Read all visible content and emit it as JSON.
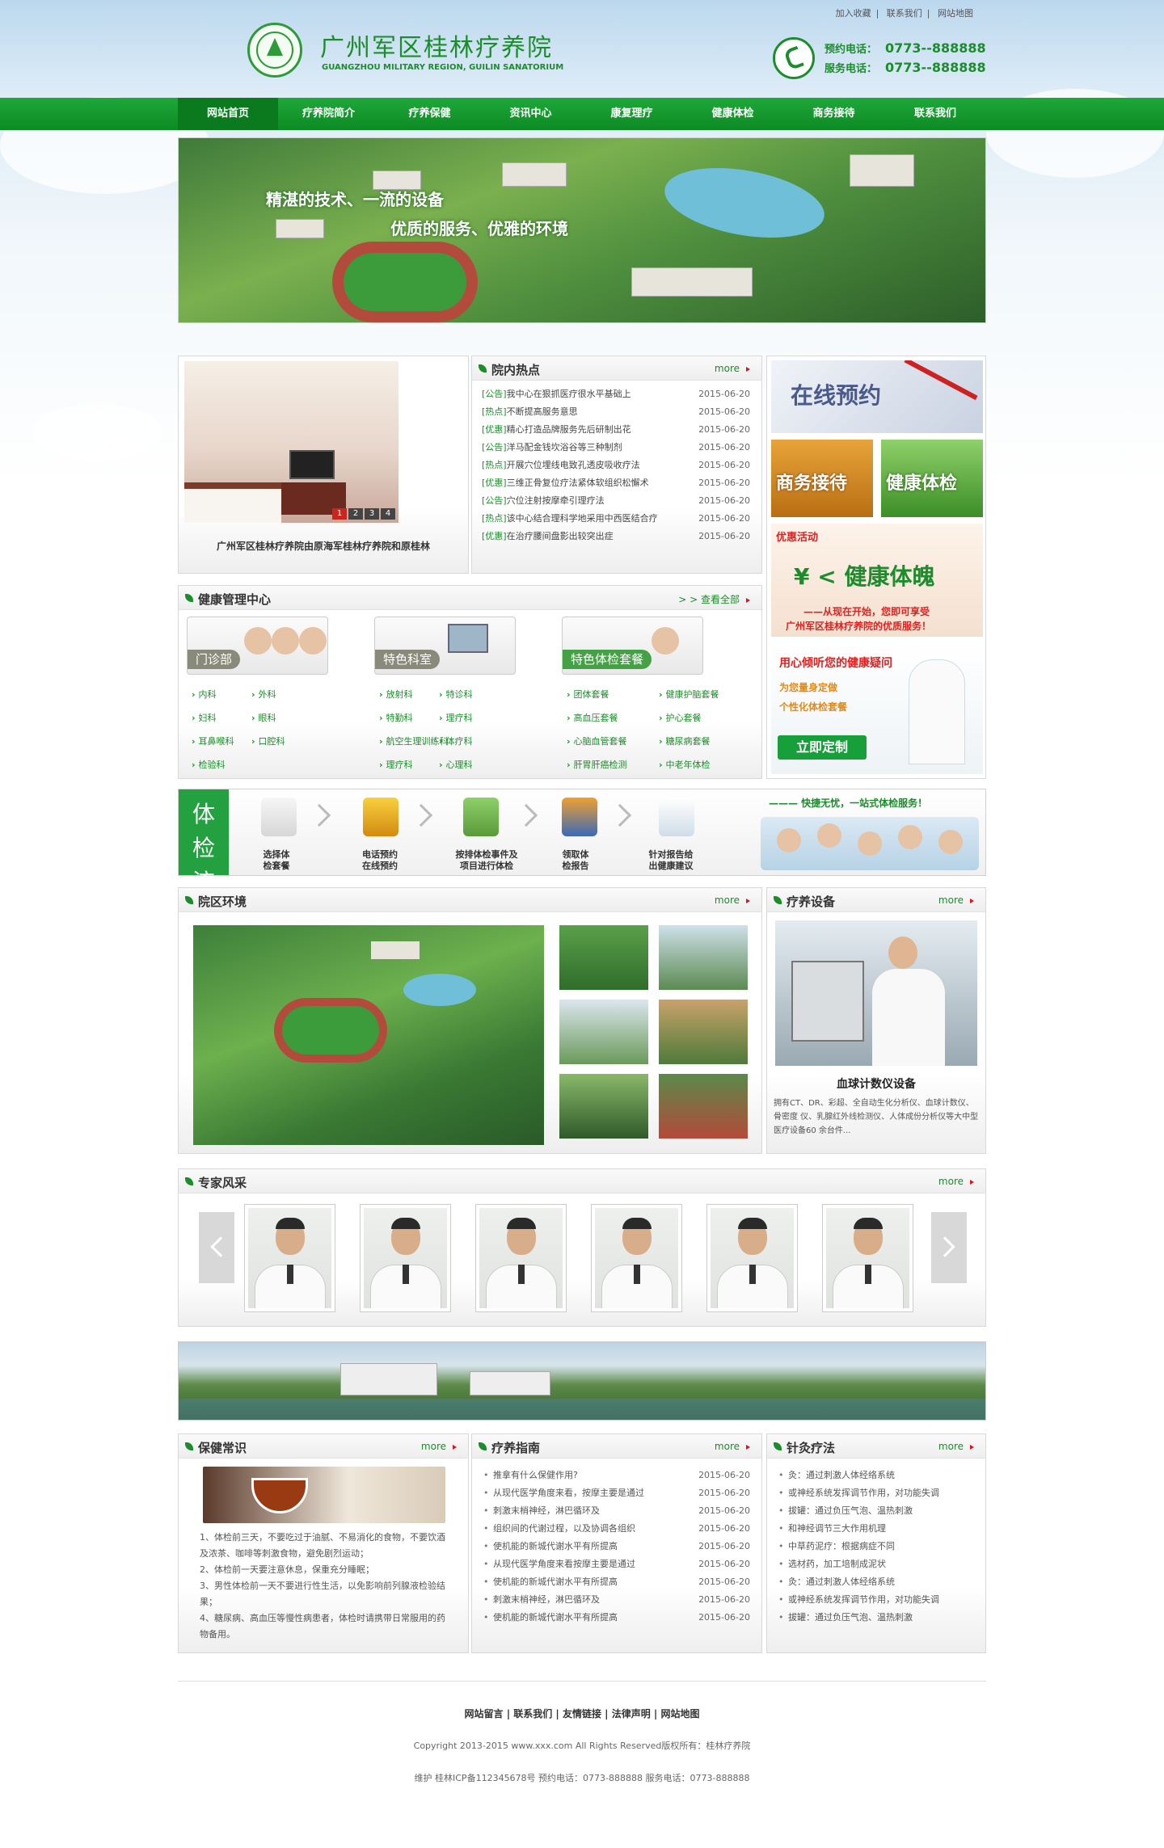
{
  "header": {
    "logo_cn": "广州军区桂林疗养院",
    "logo_en": "GUANGZHOU MILITARY REGION, GUILIN SANATORIUM",
    "top_links": [
      "加入收藏",
      "联系我们",
      "网站地图"
    ],
    "booking_label": "预约电话：",
    "booking_number": "0773--888888",
    "service_label": "服务电话：",
    "service_number": "0773--888888"
  },
  "nav": [
    "网站首页",
    "疗养院简介",
    "疗养保健",
    "资讯中心",
    "康复理疗",
    "健康体检",
    "商务接待",
    "联系我们"
  ],
  "banner": {
    "slogan1": "精湛的技术、一流的设备",
    "slogan2": "优质的服务、优雅的环境"
  },
  "slider": {
    "caption": "广州军区桂林疗养院由原海军桂林疗养院和原桂林",
    "pages": [
      "1",
      "2",
      "3",
      "4"
    ]
  },
  "hot": {
    "title": "院内热点",
    "more": "more",
    "items": [
      {
        "tag": "[公告]",
        "text": "我中心在狠抓医疗很水平基础上",
        "date": "2015-06-20"
      },
      {
        "tag": "[热点]",
        "text": "不断提高服务意思",
        "date": "2015-06-20"
      },
      {
        "tag": "[优惠]",
        "text": "精心打造品牌服务先后研制出花",
        "date": "2015-06-20"
      },
      {
        "tag": "[公告]",
        "text": "洋马配金钱坎浴谷等三种制剂",
        "date": "2015-06-20"
      },
      {
        "tag": "[热点]",
        "text": "开展穴位埋线电致孔透皮吸收疗法",
        "date": "2015-06-20"
      },
      {
        "tag": "[优惠]",
        "text": "三维正骨复位疗法紧体软组织松懈术",
        "date": "2015-06-20"
      },
      {
        "tag": "[公告]",
        "text": "穴位注射按摩牵引理疗法",
        "date": "2015-06-20"
      },
      {
        "tag": "[热点]",
        "text": "该中心结合理科学地采用中西医结合疗",
        "date": "2015-06-20"
      },
      {
        "tag": "[优惠]",
        "text": "在治疗腰间盘影出较突出症",
        "date": "2015-06-20"
      }
    ]
  },
  "ads": {
    "online": "在线预约",
    "business": "商务接待",
    "checkup": "健康体检",
    "promo_tag": "优惠活动",
    "promo_big": "¥ < 健康体魄",
    "promo_line1": "——从现在开始，您即可享受",
    "promo_line2": "广州军区桂林疗养院的优质服务！",
    "custom_title": "用心倾听您的健康疑问",
    "custom_line1": "为您量身定做",
    "custom_line2": "个性化体检套餐",
    "custom_button": "立即定制"
  },
  "health": {
    "title": "健康管理中心",
    "more": "> > 查看全部",
    "cards": [
      "门诊部",
      "特色科室",
      "特色体检套餐"
    ],
    "col1": [
      "内科",
      "外科",
      "妇科",
      "眼科",
      "耳鼻喉科",
      "口腔科",
      "检验科"
    ],
    "col2": [
      "放射科",
      "特诊科",
      "特勤科",
      "理疗科",
      "航空生理训练科",
      "体疗科",
      "理疗科",
      "心理科"
    ],
    "col3": [
      "团体套餐",
      "健康护脑套餐",
      "高血压套餐",
      "护心套餐",
      "心脑血管套餐",
      "糖尿病套餐",
      "肝胃肝癌检测",
      "中老年体检"
    ]
  },
  "flow": {
    "title1": "体 检",
    "title2": "流 程",
    "steps": [
      [
        "选择体",
        "检套餐"
      ],
      [
        "电话预约",
        "在线预约"
      ],
      [
        "按排体检事件及",
        "项目进行体检"
      ],
      [
        "领取体",
        "检报告"
      ],
      [
        "针对报告给",
        "出健康建议"
      ]
    ],
    "slogan": "——— 快捷无忧，一站式体检服务！"
  },
  "env": {
    "title": "院区环境",
    "more": "more"
  },
  "equip": {
    "title": "疗养设备",
    "more": "more",
    "name": "血球计数仪设备",
    "desc": "拥有CT、DR、彩超、全自动生化分析仪、血球计数仪、骨密度 仪、乳腺红外线检测仪、人体成份分析仪等大中型医疗设备60 余台件..."
  },
  "experts": {
    "title": "专家风采",
    "more": "more"
  },
  "care": {
    "title": "保健常识",
    "more": "more",
    "text": [
      "1、体检前三天，不要吃过于油腻、不易消化的食物，不要饮酒及浓茶、咖啡等刺激食物，避免剧烈运动；",
      "2、体检前一天要注意休息，保重充分睡眠；",
      "3、男性体检前一天不要进行性生活，以免影响前列腺液检验结果；",
      "4、糖尿病、高血压等慢性病患者，体检时请携带日常服用的药物备用。"
    ]
  },
  "guide": {
    "title": "疗养指南",
    "more": "more",
    "items": [
      {
        "text": "推拿有什么保健作用?",
        "date": "2015-06-20"
      },
      {
        "text": "从现代医学角度来看，按摩主要是通过",
        "date": "2015-06-20"
      },
      {
        "text": "刺激末梢神经，淋巴循环及",
        "date": "2015-06-20"
      },
      {
        "text": "组织间的代谢过程，以及协调各组织",
        "date": "2015-06-20"
      },
      {
        "text": "使机能的新城代谢水平有所提高",
        "date": "2015-06-20"
      },
      {
        "text": "从现代医学角度来看按摩主要是通过",
        "date": "2015-06-20"
      },
      {
        "text": "使机能的新城代谢水平有所提高",
        "date": "2015-06-20"
      },
      {
        "text": "刺激末梢神经，淋巴循环及",
        "date": "2015-06-20"
      },
      {
        "text": "使机能的新城代谢水平有所提高",
        "date": "2015-06-20"
      }
    ]
  },
  "acu": {
    "title": "针灸疗法",
    "more": "more",
    "items": [
      "灸：通过刺激人体经络系统",
      "或神经系统发挥调节作用，对功能失调",
      "拔罐：通过负压气泡、温热刺激",
      "和神经调节三大作用机理",
      "中草药泥疗：根据病症不同",
      "选材药，加工培制成泥状",
      "灸：通过刺激人体经络系统",
      "或神经系统发挥调节作用，对功能失调",
      "拔罐：通过负压气泡、温热刺激"
    ]
  },
  "footer": {
    "links": "网站留言 | 联系我们 | 友情链接 | 法律声明 | 网站地图",
    "copyright": "Copyright 2013-2015 www.xxx.com All Rights Reserved版权所有：桂林疗养院",
    "icp": "维护 桂林ICP备112345678号 预约电话：0773-888888 服务电话：0773-888888"
  },
  "colors": {
    "brand": "#1c8c2c",
    "nav": "#1fa83a",
    "accent_red": "#c8261e"
  }
}
